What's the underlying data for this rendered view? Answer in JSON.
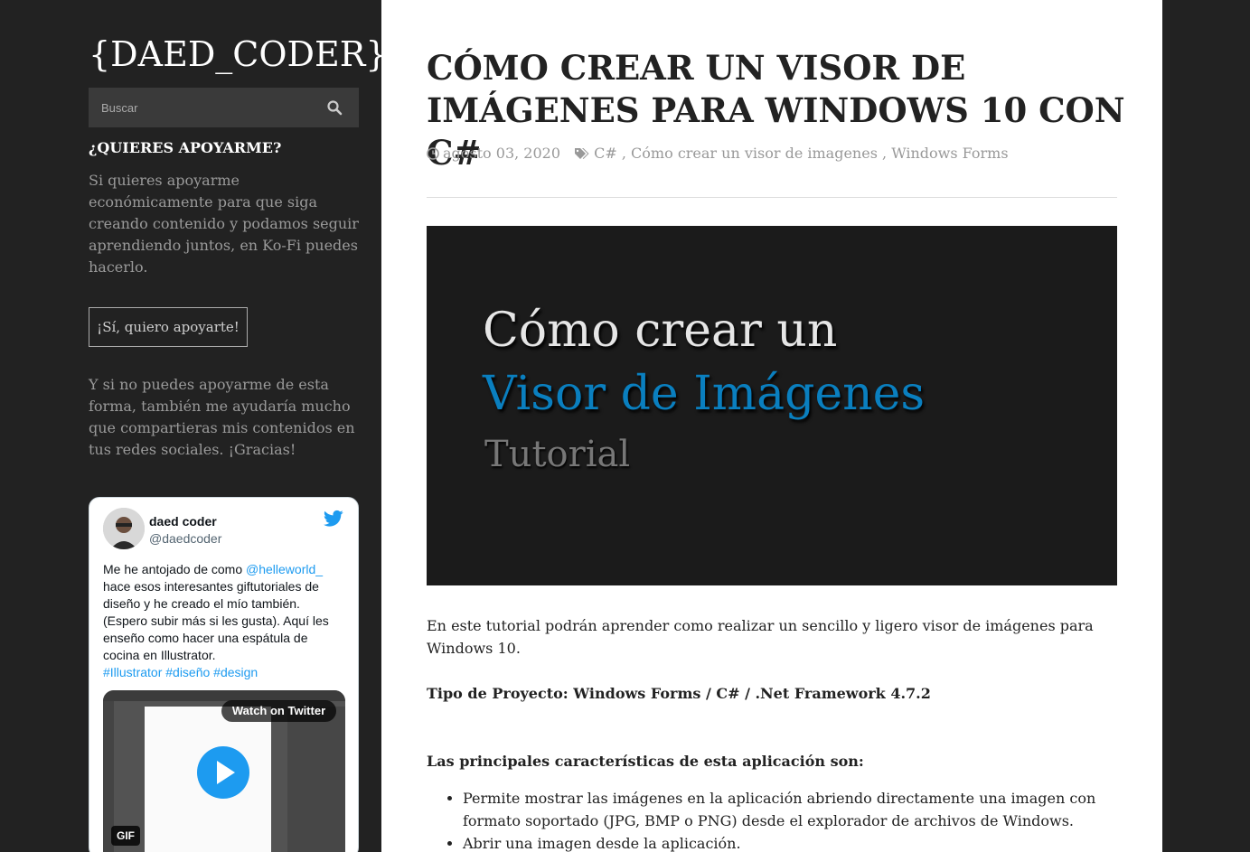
{
  "sidebar": {
    "logo": "{DAED_CODER}",
    "search": {
      "placeholder": "Buscar",
      "icon": "search-icon"
    },
    "support": {
      "title": "¿QUIERES APOYARME?",
      "text": "Si quieres apoyarme económicamente para que siga creando contenido y podamos seguir aprendiendo juntos, en Ko-Fi puedes hacerlo.",
      "button_label": "¡Sí, quiero apoyarte!",
      "share_text": "Y si no puedes apoyarme de esta forma, también me ayudaría mucho que compartieras mis contenidos en tus redes sociales. ¡Gracias!"
    },
    "tweet": {
      "name": "daed coder",
      "handle": "@daedcoder",
      "text_before": "Me he antojado de como ",
      "mention": "@helleworld_",
      "text_after": " hace esos interesantes giftutoriales de diseño y he creado el mío también. (Espero subir más si les gusta). Aquí les enseño como hacer una espátula de cocina en Illustrator.",
      "hashtags": "#Illustrator #diseño #design",
      "watch_label": "Watch on Twitter",
      "gif_label": "GIF"
    }
  },
  "post": {
    "title": "CÓMO CREAR UN VISOR DE IMÁGENES PARA WINDOWS 10 CON C#",
    "date": "agosto 03, 2020",
    "tags": [
      "C#",
      "Cómo crear un visor de imagenes",
      "Windows Forms"
    ],
    "hero": {
      "line1": "Cómo crear un",
      "line2": "Visor de Imágenes",
      "line3": "Tutorial"
    },
    "intro": "En este tutorial podrán aprender como realizar un sencillo y ligero visor de imágenes para Windows 10.",
    "project_type": "Tipo de Proyecto: Windows Forms / C# / .Net Framework 4.7.2",
    "features_title": "Las principales características de esta aplicación son:",
    "features": [
      "Permite mostrar las imágenes en la aplicación abriendo directamente una imagen con formato soportado (JPG, BMP o PNG) desde el explorador de archivos de Windows.",
      "Abrir una imagen desde la aplicación."
    ]
  },
  "colors": {
    "accent": "#0a7fbf",
    "twitter": "#1d9bf0",
    "sidebar_bg": "#222222"
  }
}
